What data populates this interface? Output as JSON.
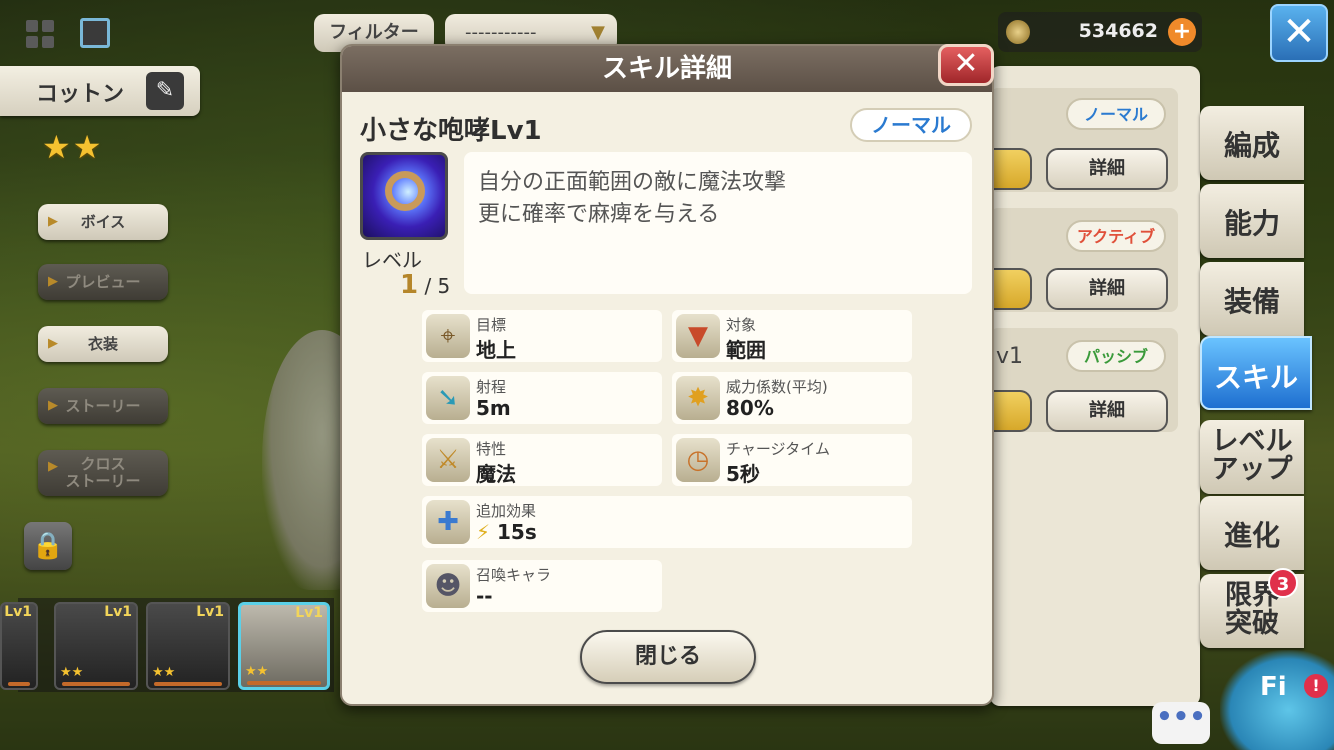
{
  "top": {
    "filter_label": "フィルター",
    "filter_value": "-----------",
    "coins": "534662",
    "plus": "+",
    "close_glyph": "✕"
  },
  "character": {
    "name": "コットン",
    "rarity_stars": "★★",
    "buttons": [
      {
        "label": "ボイス"
      },
      {
        "label": "プレビュー"
      },
      {
        "label": "衣装"
      },
      {
        "label": "ストーリー"
      },
      {
        "label_line1": "クロス",
        "label_line2": "ストーリー"
      }
    ],
    "party": [
      {
        "lv": "Lv1",
        "stars": "★★"
      },
      {
        "lv": "Lv1",
        "stars": "★★"
      },
      {
        "lv": "Lv1",
        "stars": "★★"
      },
      {
        "lv": "Lv1",
        "stars": ""
      }
    ]
  },
  "right_panel": {
    "tags": [
      "ノーマル",
      "アクティブ",
      "パッシブ"
    ],
    "detail_label": "詳細",
    "lv_text": "v1",
    "tabs": [
      "編成",
      "能力",
      "装備",
      "スキル"
    ],
    "tab_level_up": [
      "レベル",
      "アップ"
    ],
    "tab_evolve": "進化",
    "tab_limit": [
      "限界",
      "突破"
    ],
    "limit_badge": "3",
    "chat_glyph": "•••",
    "mascot_text": "Fi",
    "mascot_badge": "!"
  },
  "modal": {
    "title": "スキル詳細",
    "close_glyph": "✕",
    "skill_name": "小さな咆哮Lv1",
    "skill_type": "ノーマル",
    "level_label": "レベル",
    "level_current": "1",
    "level_max": "/ 5",
    "description": [
      "自分の正面範囲の敵に魔法攻撃",
      "更に確率で麻痺を与える"
    ],
    "stats": {
      "target": {
        "label": "目標",
        "value": "地上"
      },
      "subject": {
        "label": "対象",
        "value": "範囲"
      },
      "range": {
        "label": "射程",
        "value": "5m"
      },
      "power": {
        "label": "威力係数(平均)",
        "value": "80%"
      },
      "attribute": {
        "label": "特性",
        "value": "魔法"
      },
      "charge": {
        "label": "チャージタイム",
        "value": "5秒"
      },
      "extra": {
        "label": "追加効果",
        "value": "15s"
      },
      "summon": {
        "label": "召喚キャラ",
        "value": "--"
      }
    },
    "close_button": "閉じる"
  }
}
